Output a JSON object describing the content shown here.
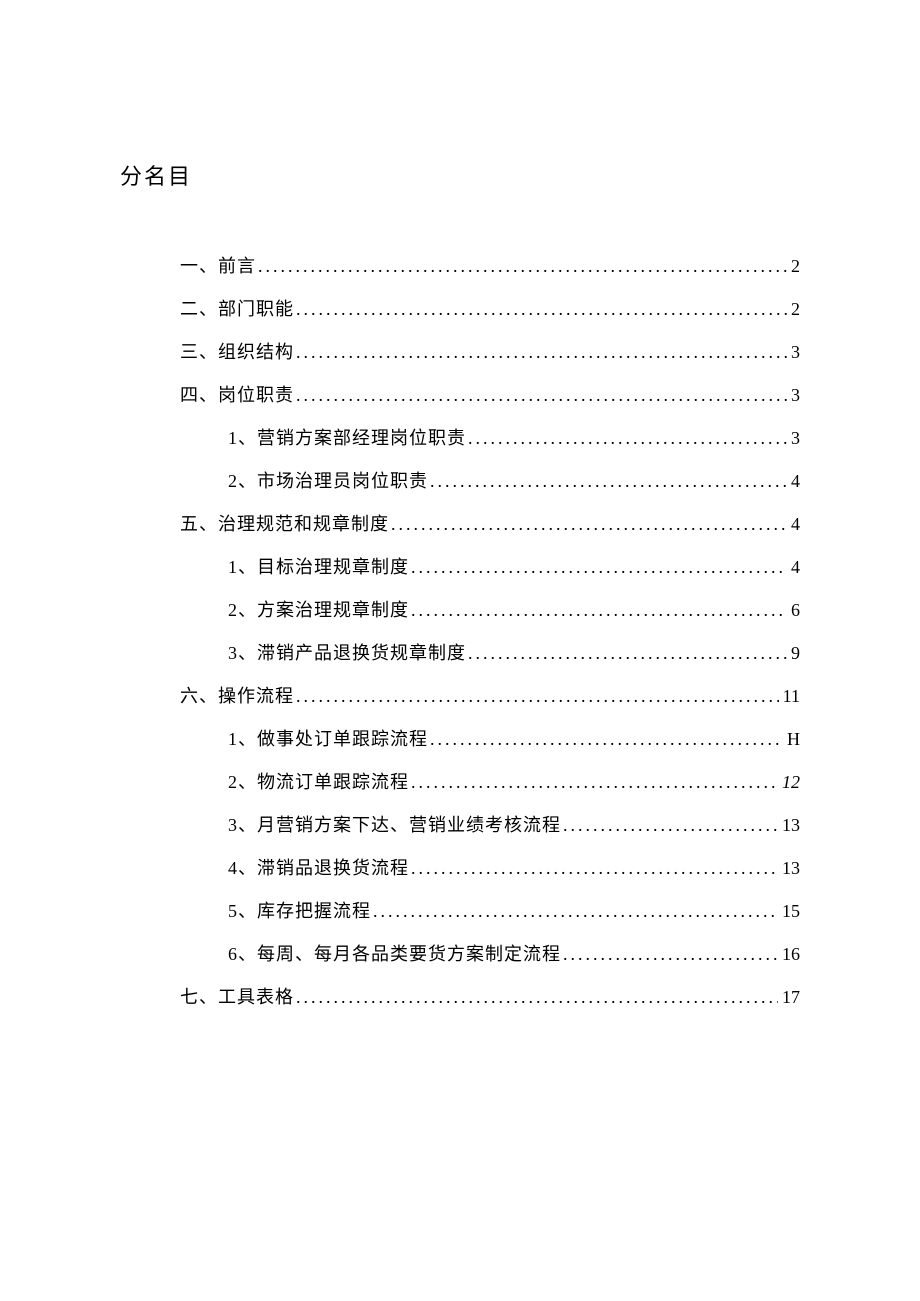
{
  "title": "分名目",
  "entries": [
    {
      "level": 1,
      "label": "一、前言",
      "page": "2",
      "italic": false
    },
    {
      "level": 1,
      "label": "二、部门职能",
      "page": "2",
      "italic": false
    },
    {
      "level": 1,
      "label": "三、组织结构",
      "page": "3",
      "italic": false
    },
    {
      "level": 1,
      "label": "四、岗位职责",
      "page": "3",
      "italic": false
    },
    {
      "level": 2,
      "label": "1、营销方案部经理岗位职责",
      "page": "3",
      "italic": false
    },
    {
      "level": 2,
      "label": "2、市场治理员岗位职责",
      "page": "4",
      "italic": false
    },
    {
      "level": 1,
      "label": "五、治理规范和规章制度",
      "page": "4",
      "italic": false
    },
    {
      "level": 2,
      "label": "1、目标治理规章制度",
      "page": "4",
      "italic": false
    },
    {
      "level": 2,
      "label": "2、方案治理规章制度",
      "page": "6",
      "italic": false
    },
    {
      "level": 2,
      "label": "3、滞销产品退换货规章制度",
      "page": "9",
      "italic": false
    },
    {
      "level": 1,
      "label": "六、操作流程",
      "page": "11",
      "italic": false
    },
    {
      "level": 2,
      "label": "1、做事处订单跟踪流程",
      "page": "H",
      "italic": false
    },
    {
      "level": 2,
      "label": "2、物流订单跟踪流程",
      "page": "12",
      "italic": true
    },
    {
      "level": 2,
      "label": "3、月营销方案下达、营销业绩考核流程",
      "page": "13",
      "italic": false
    },
    {
      "level": 2,
      "label": "4、滞销品退换货流程",
      "page": "13",
      "italic": false
    },
    {
      "level": 2,
      "label": "5、库存把握流程",
      "page": "15",
      "italic": false
    },
    {
      "level": 2,
      "label": "6、每周、每月各品类要货方案制定流程",
      "page": "16",
      "italic": false
    },
    {
      "level": 1,
      "label": "七、工具表格",
      "page": "17",
      "italic": false
    }
  ]
}
